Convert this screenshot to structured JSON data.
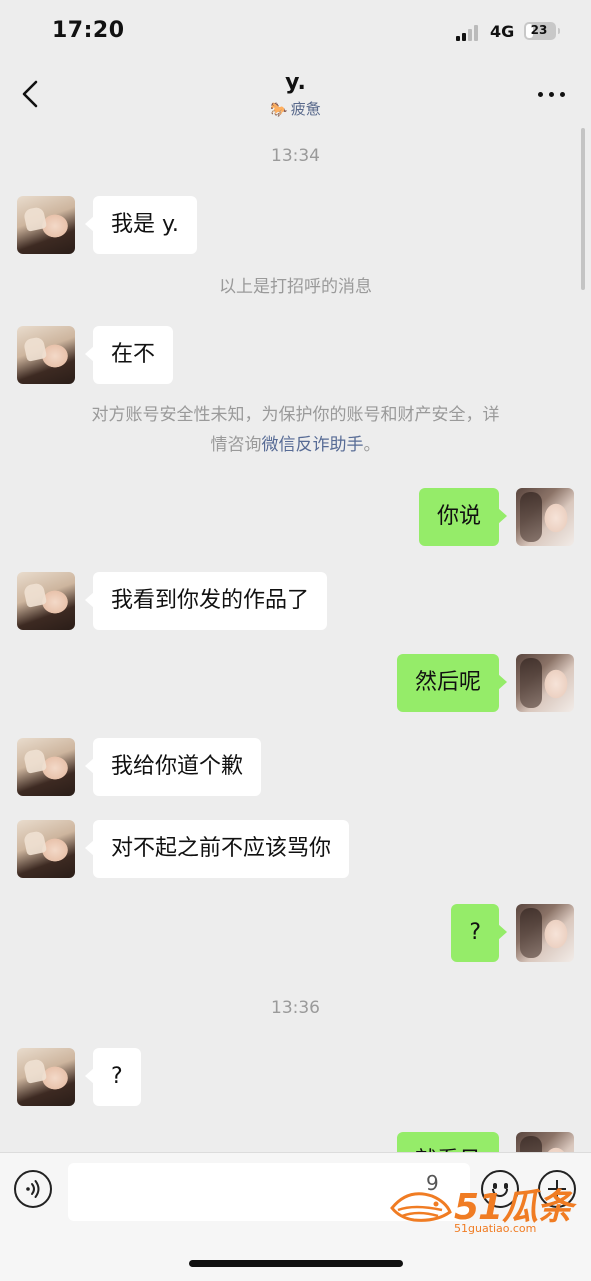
{
  "status_bar": {
    "time": "17:20",
    "network": "4G",
    "battery_level": "23",
    "battery_charging": true
  },
  "nav": {
    "title": "y.",
    "status_icon": "rocking-horse-icon",
    "status_glyph": "🐎",
    "status_text": "疲惫",
    "back_icon": "chevron-left-icon",
    "more_icon": "more-dots-icon"
  },
  "chat": {
    "timestamp_1": "13:34",
    "timestamp_2": "13:36",
    "greeting_notice": "以上是打招呼的消息",
    "security_notice_line1": "对方账号安全性未知，为保护你的账号和财产安全，详",
    "security_notice_line2_prefix": "情咨询",
    "security_notice_link": "微信反诈助手",
    "security_notice_suffix": "。",
    "messages": [
      {
        "sender": "them",
        "text": "我是 y."
      },
      {
        "sender": "them",
        "text": "在不"
      },
      {
        "sender": "me",
        "text": "你说"
      },
      {
        "sender": "them",
        "text": "我看到你发的作品了"
      },
      {
        "sender": "me",
        "text": "然后呢"
      },
      {
        "sender": "them",
        "text": "我给你道个歉"
      },
      {
        "sender": "them",
        "text": "对不起之前不应该骂你"
      },
      {
        "sender": "me",
        "text": "?"
      },
      {
        "sender": "them",
        "text": "?"
      },
      {
        "sender": "me",
        "text": "就看见"
      }
    ]
  },
  "input_bar": {
    "value": "",
    "trailing_char": "9",
    "voice_icon": "voice-icon",
    "emoji_icon": "emoji-icon",
    "plus_icon": "plus-icon"
  },
  "watermark": {
    "main": "51瓜条",
    "sub": "51guatiao.com"
  },
  "colors": {
    "background": "#ededed",
    "bubble_me": "#95ec69",
    "bubble_them": "#ffffff",
    "link": "#576b95",
    "watermark": "#f07c23"
  }
}
